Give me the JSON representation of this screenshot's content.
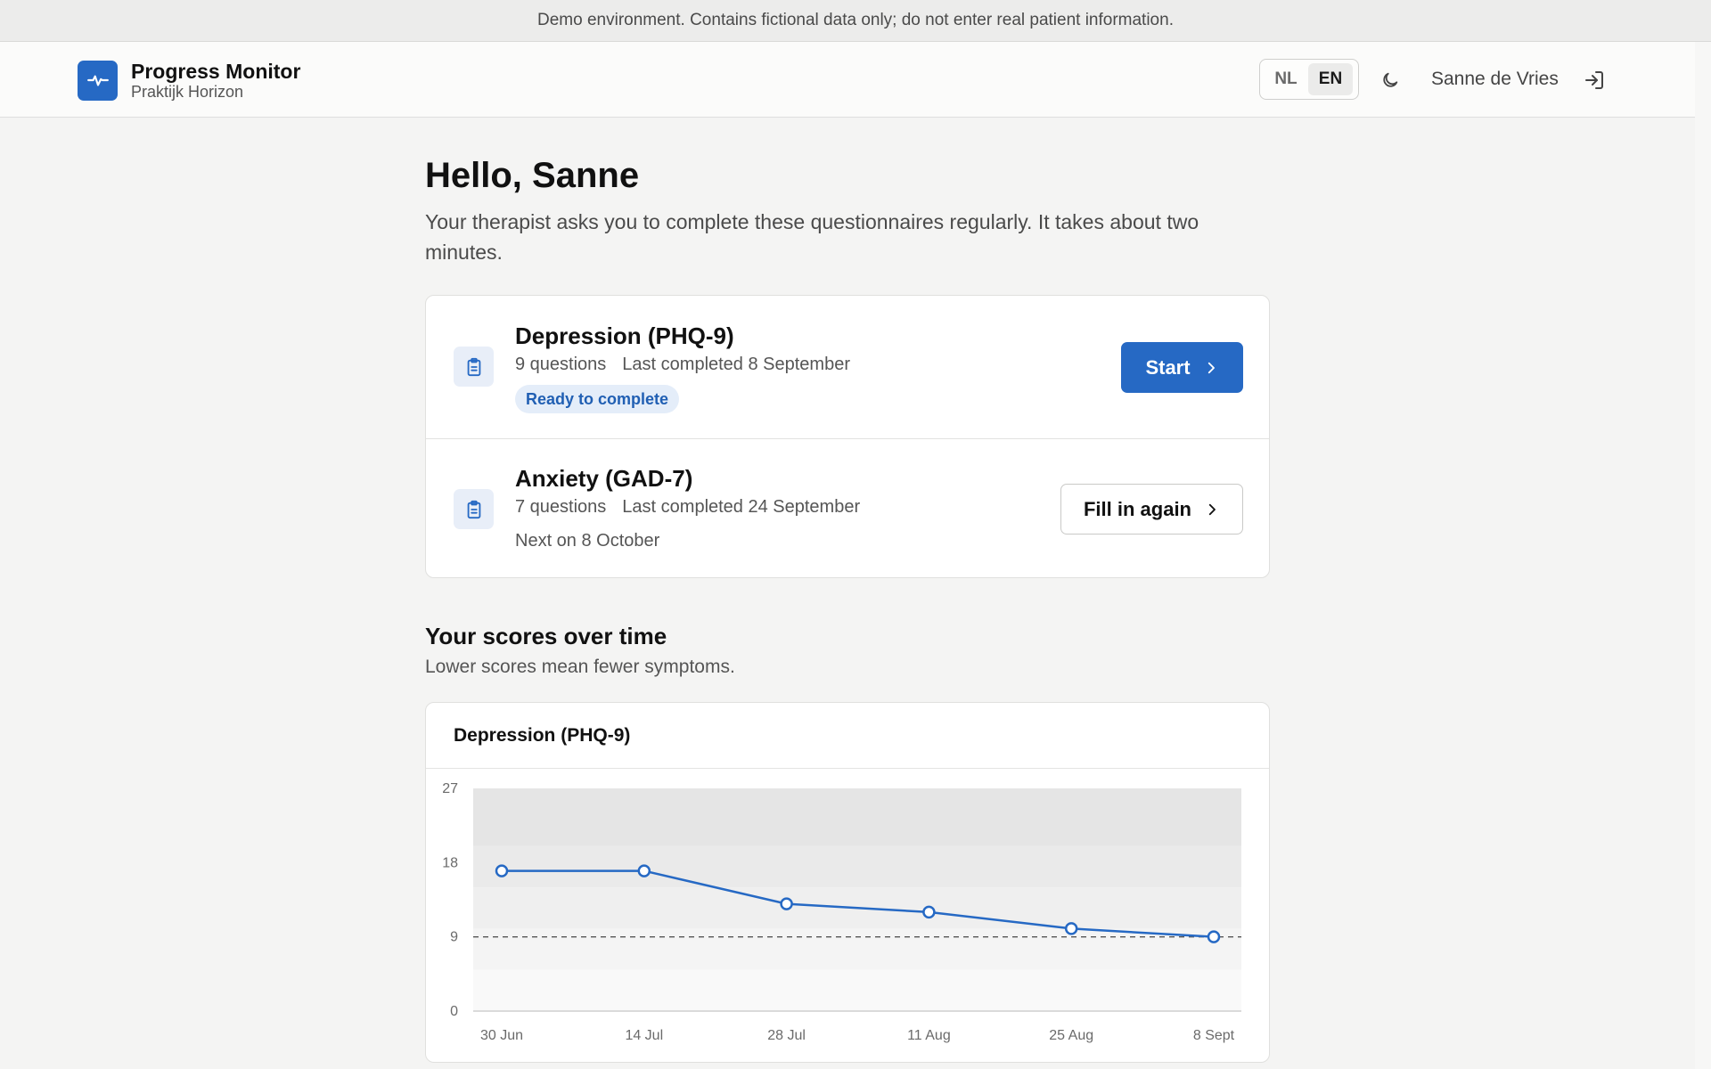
{
  "banner": {
    "text": "Demo environment. Contains fictional data only; do not enter real patient information."
  },
  "header": {
    "app_title": "Progress Monitor",
    "practice": "Praktijk Horizon",
    "languages": [
      "NL",
      "EN"
    ],
    "active_language": "EN",
    "user_name": "Sanne de Vries"
  },
  "main": {
    "greeting": "Hello, Sanne",
    "intro": "Your therapist asks you to complete these questionnaires regularly. It takes about two minutes."
  },
  "questionnaires": [
    {
      "title": "Depression (PHQ-9)",
      "questions": "9 questions",
      "last_completed": "Last completed 8 September",
      "status": "Ready to complete",
      "action": "Start"
    },
    {
      "title": "Anxiety (GAD-7)",
      "questions": "7 questions",
      "last_completed": "Last completed 24 September",
      "next": "Next on 8 October",
      "action": "Fill in again"
    }
  ],
  "scores": {
    "title": "Your scores over time",
    "subtitle": "Lower scores mean fewer symptoms."
  },
  "colors": {
    "accent": "#2669c4",
    "badge_bg": "#e4edf9",
    "page_bg": "#f4f4f3"
  },
  "chart_data": {
    "type": "line",
    "title": "Depression (PHQ-9)",
    "categories": [
      "30 Jun",
      "14 Jul",
      "28 Jul",
      "11 Aug",
      "25 Aug",
      "8 Sept"
    ],
    "series": [
      {
        "values": [
          17,
          17,
          13,
          12,
          10,
          9
        ]
      }
    ],
    "ylim": [
      0,
      27
    ],
    "yticks": [
      0,
      9,
      18,
      27
    ],
    "bands": [
      [
        0,
        5
      ],
      [
        5,
        10
      ],
      [
        10,
        15
      ],
      [
        15,
        20
      ],
      [
        20,
        27
      ]
    ],
    "reference_line": 9,
    "grid": false
  }
}
